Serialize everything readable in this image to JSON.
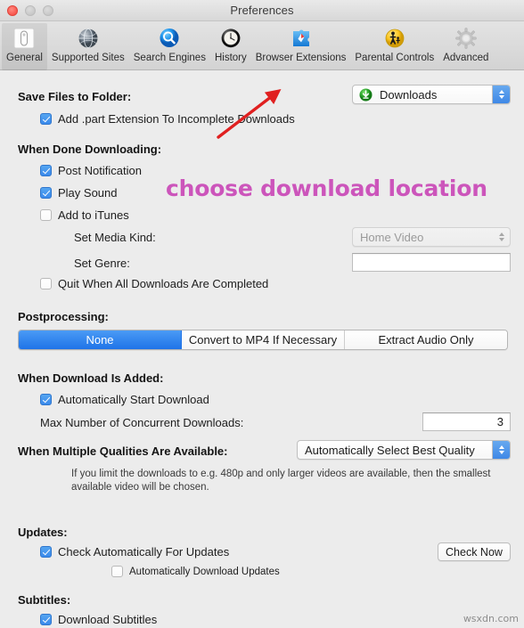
{
  "window": {
    "title": "Preferences",
    "traffic_lights": [
      "close",
      "minimize",
      "maximize"
    ]
  },
  "toolbar": {
    "items": [
      {
        "label": "General",
        "icon": "general-switch-icon",
        "selected": true
      },
      {
        "label": "Supported Sites",
        "icon": "globe-icon",
        "selected": false
      },
      {
        "label": "Search Engines",
        "icon": "magnifier-icon",
        "selected": false
      },
      {
        "label": "History",
        "icon": "clock-icon",
        "selected": false
      },
      {
        "label": "Browser Extensions",
        "icon": "puzzle-compass-icon",
        "selected": false
      },
      {
        "label": "Parental Controls",
        "icon": "parental-figure-icon",
        "selected": false
      },
      {
        "label": "Advanced",
        "icon": "gear-icon",
        "selected": false
      }
    ]
  },
  "sections": {
    "save_files": {
      "title": "Save Files to Folder:",
      "folder_value": "Downloads",
      "part_extension": {
        "label": "Add .part Extension To Incomplete Downloads",
        "checked": true
      }
    },
    "when_done": {
      "title": "When Done Downloading:",
      "post_notification": {
        "label": "Post Notification",
        "checked": true
      },
      "play_sound": {
        "label": "Play Sound",
        "checked": true
      },
      "add_to_itunes": {
        "label": "Add to iTunes",
        "checked": false
      },
      "set_media_kind_label": "Set Media Kind:",
      "set_media_kind_value": "Home Video",
      "set_genre_label": "Set Genre:",
      "set_genre_value": "",
      "quit_when_done": {
        "label": "Quit When All Downloads Are Completed",
        "checked": false
      }
    },
    "postprocessing": {
      "title": "Postprocessing:",
      "options": [
        "None",
        "Convert to MP4 If Necessary",
        "Extract Audio Only"
      ],
      "selected_index": 0
    },
    "when_added": {
      "title": "When Download Is Added:",
      "auto_start": {
        "label": "Automatically Start Download",
        "checked": true
      },
      "max_concurrent_label": "Max Number of Concurrent Downloads:",
      "max_concurrent_value": "3"
    },
    "qualities": {
      "title": "When Multiple Qualities Are Available:",
      "value": "Automatically Select Best Quality",
      "hint_line1": "If you limit the downloads to e.g. 480p and only larger videos are available, then the smallest",
      "hint_line2": "available video will be chosen."
    },
    "updates": {
      "title": "Updates:",
      "check_auto": {
        "label": "Check Automatically For Updates",
        "checked": true
      },
      "auto_download": {
        "label": "Automatically Download Updates",
        "checked": false
      },
      "check_now_button": "Check Now"
    },
    "subtitles": {
      "title": "Subtitles:",
      "download_subtitles": {
        "label": "Download Subtitles",
        "checked": true
      }
    }
  },
  "annotations": {
    "callout_text": "choose download location",
    "callout_color": "#cc55bb",
    "arrow_color": "#e02020"
  },
  "watermark": "wsxdn.com"
}
